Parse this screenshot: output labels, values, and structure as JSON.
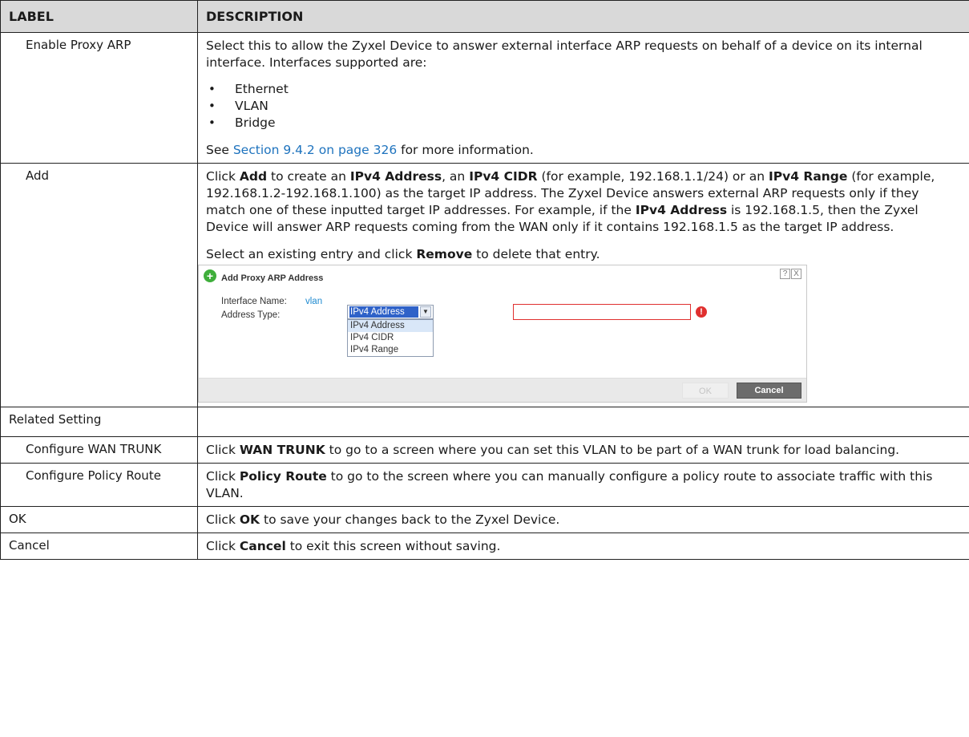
{
  "table": {
    "header": {
      "label": "LABEL",
      "description": "DESCRIPTION"
    },
    "proxy_arp": {
      "label": "Enable Proxy ARP",
      "desc_1": "Select this to allow the Zyxel Device to answer external interface ARP requests on behalf of a device on its internal interface. Interfaces supported are:",
      "bullets": [
        "Ethernet",
        "VLAN",
        "Bridge"
      ],
      "see_pre": "See ",
      "see_link": "Section 9.4.2 on page 326",
      "see_post": " for more information."
    },
    "add": {
      "label": "Add",
      "p1": {
        "t1": "Click ",
        "b1": "Add",
        "t2": " to create an ",
        "b2": "IPv4 Address",
        "t3": ", an ",
        "b3": "IPv4 CIDR",
        "t4": " (for example, 192.168.1.1/24) or an ",
        "b4": "IPv4 Range",
        "t5": " (for example, 192.168.1.2-192.168.1.100) as the target IP address. The Zyxel Device answers external ARP requests only if they match one of these inputted target IP addresses. For example, if the ",
        "b5": "IPv4 Address",
        "t6": " is 192.168.1.5, then the Zyxel Device will answer ARP requests coming from the WAN only if it contains 192.168.1.5 as the target IP address."
      },
      "p2": {
        "t1": "Select an existing entry and click ",
        "b1": "Remove",
        "t2": " to delete that entry."
      },
      "dialog": {
        "title": "Add Proxy ARP Address",
        "help": "?",
        "close": "X",
        "interface_label": "Interface Name:",
        "interface_value": "vlan",
        "address_type_label": "Address Type:",
        "address_type_selected": "IPv4 Address",
        "options": [
          "IPv4 Address",
          "IPv4 CIDR",
          "IPv4 Range"
        ],
        "ok": "OK",
        "cancel": "Cancel"
      }
    },
    "related": {
      "label": "Related Setting"
    },
    "wan_trunk": {
      "label": "Configure WAN TRUNK",
      "t1": "Click ",
      "b1": "WAN TRUNK",
      "t2": " to go to a screen where you can set this VLAN to be part of a WAN trunk for load balancing."
    },
    "policy_route": {
      "label": "Configure Policy Route",
      "t1": "Click ",
      "b1": "Policy Route",
      "t2": " to go to the screen where you can manually configure a policy route to associate traffic with this VLAN."
    },
    "ok_row": {
      "label": "OK",
      "t1": "Click ",
      "b1": "OK",
      "t2": " to save your changes back to the Zyxel Device."
    },
    "cancel_row": {
      "label": "Cancel",
      "t1": "Click ",
      "b1": "Cancel",
      "t2": " to exit this screen without saving."
    }
  }
}
